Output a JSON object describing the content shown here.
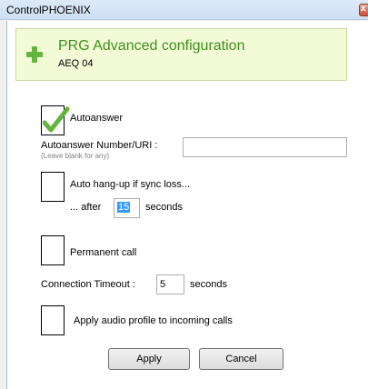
{
  "window": {
    "title": "ControlPHOENIX"
  },
  "header": {
    "title": "PRG Advanced configuration",
    "subtitle": "AEQ 04"
  },
  "autoanswer": {
    "label": "Autoanswer",
    "checked": true
  },
  "autoanswer_number": {
    "label": "Autoanswer Number/URI :",
    "hint": "(Leave blank for any)",
    "value": ""
  },
  "auto_hangup": {
    "label": "Auto hang-up if sync loss...",
    "checked": false,
    "after_label": "... after",
    "after_value": "15",
    "seconds_label": "seconds"
  },
  "permanent_call": {
    "label": "Permanent call",
    "checked": false
  },
  "connection_timeout": {
    "label": "Connection Timeout :",
    "value": "5",
    "seconds_label": "seconds"
  },
  "audio_profile": {
    "label": "Apply audio profile to incoming calls",
    "checked": false
  },
  "buttons": {
    "apply": "Apply",
    "cancel": "Cancel"
  },
  "colors": {
    "header_bg": "#f3fbd6",
    "header_title": "#3f8f1e",
    "check_green": "#63b53d"
  }
}
